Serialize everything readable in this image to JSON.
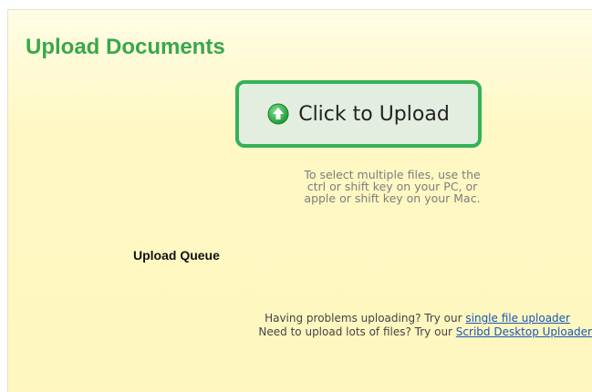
{
  "upload_panel": {
    "title": "Upload Documents",
    "upload_button": {
      "label": "Click to Upload",
      "icon": "up-arrow-circle-icon"
    },
    "hint": [
      "To select multiple files, use the",
      "ctrl or shift key on your PC, or",
      "apple or shift key on your Mac."
    ],
    "queue_label": "Upload Queue",
    "help": {
      "line1_prefix": "Having problems uploading? Try our ",
      "line1_link": "single file uploader",
      "line2_prefix": "Need to upload lots of files? Try our ",
      "line2_link": "Scribd Desktop Uploader"
    },
    "colors": {
      "title": "#3aa74a",
      "button_border": "#34b257",
      "button_bg": "#e3eee0",
      "panel_bg": "#fff8c4",
      "link": "#1a56b8"
    }
  }
}
